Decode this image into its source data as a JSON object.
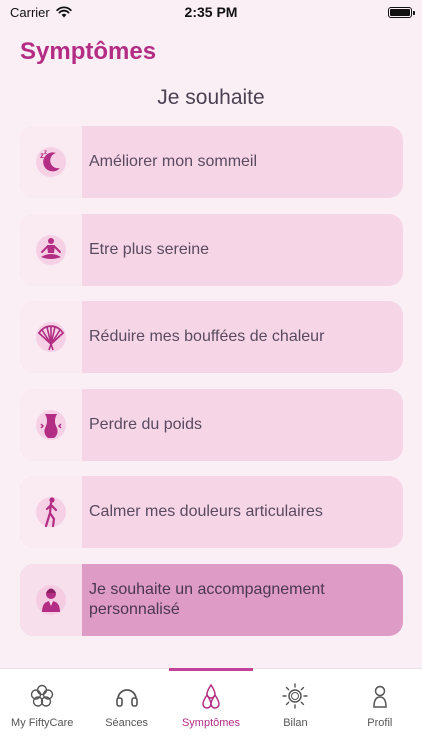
{
  "status_bar": {
    "carrier": "Carrier",
    "time": "2:35 PM"
  },
  "header": {
    "title": "Symptômes",
    "subtitle": "Je souhaite"
  },
  "items": [
    {
      "label": "Améliorer mon sommeil",
      "icon": "sleep-moon-icon"
    },
    {
      "label": "Etre plus sereine",
      "icon": "meditation-icon"
    },
    {
      "label": "Réduire mes bouffées de chaleur",
      "icon": "fan-icon"
    },
    {
      "label": "Perdre du poids",
      "icon": "waist-icon"
    },
    {
      "label": "Calmer mes douleurs articulaires",
      "icon": "joint-pain-icon"
    },
    {
      "label": "Je souhaite un accompagnement personnalisé",
      "icon": "coach-icon"
    }
  ],
  "tabs": [
    {
      "label": "My FiftyCare",
      "icon": "flower-icon"
    },
    {
      "label": "Séances",
      "icon": "headphones-icon"
    },
    {
      "label": "Symptômes",
      "icon": "drops-icon"
    },
    {
      "label": "Bilan",
      "icon": "sun-icon"
    },
    {
      "label": "Profil",
      "icon": "profile-icon"
    }
  ],
  "colors": {
    "accent": "#b22d83",
    "card": "#f6d6e6",
    "card_highlight": "#dd9bc5",
    "background": "#fbeff6"
  }
}
